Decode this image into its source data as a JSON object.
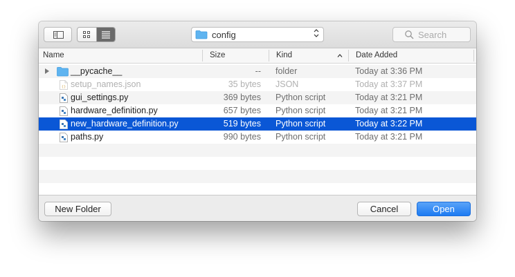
{
  "toolbar": {
    "location": "config",
    "search_placeholder": "Search"
  },
  "columns": {
    "name": "Name",
    "size": "Size",
    "kind": "Kind",
    "date": "Date Added"
  },
  "rows": [
    {
      "name": "__pycache__",
      "size": "--",
      "kind": "folder",
      "date": "Today at 3:36 PM"
    },
    {
      "name": "setup_names.json",
      "size": "35 bytes",
      "kind": "JSON",
      "date": "Today at 3:37 PM"
    },
    {
      "name": "gui_settings.py",
      "size": "369 bytes",
      "kind": "Python script",
      "date": "Today at 3:21 PM"
    },
    {
      "name": "hardware_definition.py",
      "size": "657 bytes",
      "kind": "Python script",
      "date": "Today at 3:21 PM"
    },
    {
      "name": "new_hardware_definition.py",
      "size": "519 bytes",
      "kind": "Python script",
      "date": "Today at 3:22 PM"
    },
    {
      "name": "paths.py",
      "size": "990 bytes",
      "kind": "Python script",
      "date": "Today at 3:21 PM"
    }
  ],
  "footer": {
    "new_folder": "New Folder",
    "cancel": "Cancel",
    "open": "Open"
  },
  "colors": {
    "selection": "#0a57d6",
    "primary_button": "#1d7bf2",
    "folder": "#5fb4f0"
  }
}
